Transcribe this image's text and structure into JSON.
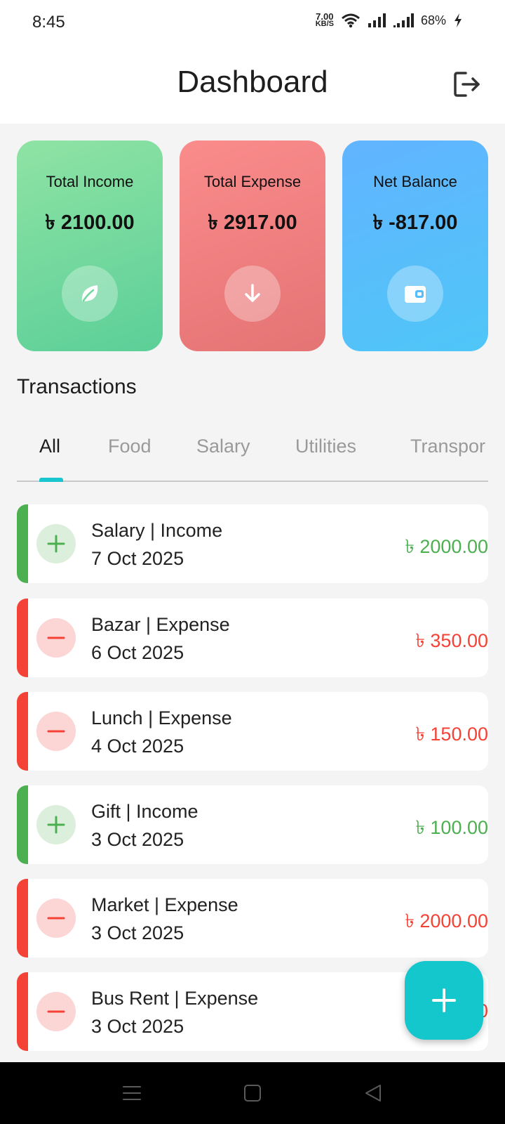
{
  "status_bar": {
    "time": "8:45",
    "net_speed_value": "7.00",
    "net_speed_unit": "KB/S",
    "battery": "68%"
  },
  "header": {
    "title": "Dashboard",
    "logout_icon": "logout-icon"
  },
  "summary": {
    "income": {
      "label": "Total Income",
      "value": "৳ 2100.00",
      "icon": "leaf-icon"
    },
    "expense": {
      "label": "Total Expense",
      "value": "৳ 2917.00",
      "icon": "arrow-down-icon"
    },
    "balance": {
      "label": "Net Balance",
      "value": "৳ -817.00",
      "icon": "wallet-icon"
    }
  },
  "transactions_title": "Transactions",
  "tabs": [
    "All",
    "Food",
    "Salary",
    "Utilities",
    "Transpor"
  ],
  "active_tab": "All",
  "transactions": [
    {
      "title": "Salary | Income",
      "date": "7 Oct 2025",
      "amount": "৳ 2000.00",
      "type": "income"
    },
    {
      "title": "Bazar | Expense",
      "date": "6 Oct 2025",
      "amount": "৳ 350.00",
      "type": "expense"
    },
    {
      "title": "Lunch | Expense",
      "date": "4 Oct 2025",
      "amount": "৳ 150.00",
      "type": "expense"
    },
    {
      "title": "Gift | Income",
      "date": "3 Oct 2025",
      "amount": "৳ 100.00",
      "type": "income"
    },
    {
      "title": "Market | Expense",
      "date": "3 Oct 2025",
      "amount": "৳ 2000.00",
      "type": "expense"
    },
    {
      "title": "Bus Rent | Expense",
      "date": "3 Oct 2025",
      "amount": "0",
      "type": "expense"
    }
  ],
  "colors": {
    "income": "#4caf50",
    "expense": "#f44336",
    "accent": "#13c7cc",
    "income_card": "#6fd89c",
    "expense_card": "#f07e7f",
    "balance_card": "#58bdfb"
  },
  "icons": {
    "fab": "plus-icon",
    "income_tx": "plus-icon",
    "expense_tx": "minus-icon",
    "nav": [
      "menu-icon",
      "home-square-icon",
      "back-triangle-icon"
    ]
  }
}
